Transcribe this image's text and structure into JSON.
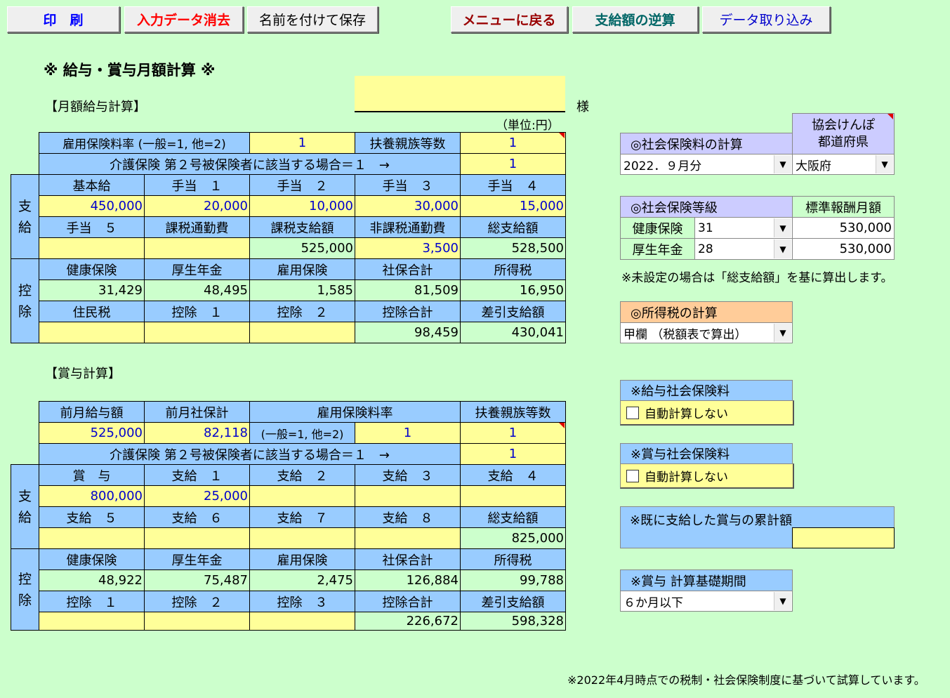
{
  "toolbar": {
    "print": "印　刷",
    "clear": "入力データ消去",
    "save_as": "名前を付けて保存",
    "menu": "メニューに戻る",
    "reverse": "支給額の逆算",
    "import": "データ取り込み"
  },
  "page_title": "※ 給与・賞与月額計算 ※",
  "monthly": {
    "section_label": "【月額給与計算】",
    "name_value": "",
    "sama": "様",
    "unit": "（単位:円）",
    "rate_label": "雇用保険料率 (一般=1, 他=2)",
    "rate_value": "1",
    "dependents_label": "扶養親族等数",
    "dependents_value": "1",
    "kaigo_label": "介護保険 第２号被保険者に該当する場合＝１　→",
    "kaigo_value": "1",
    "pay_side": [
      "支",
      "給"
    ],
    "ded_side": [
      "控",
      "除"
    ],
    "pay_h1": [
      "基本給",
      "手当　１",
      "手当　２",
      "手当　３",
      "手当　４"
    ],
    "pay_v1": [
      "450,000",
      "20,000",
      "10,000",
      "30,000",
      "15,000"
    ],
    "pay_h2": [
      "手当　５",
      "課税通勤費",
      "課税支給額",
      "非課税通勤費",
      "総支給額"
    ],
    "pay_v2": [
      "",
      "",
      "525,000",
      "3,500",
      "528,500"
    ],
    "ded_h1": [
      "健康保険",
      "厚生年金",
      "雇用保険",
      "社保合計",
      "所得税"
    ],
    "ded_v1": [
      "31,429",
      "48,495",
      "1,585",
      "81,509",
      "16,950"
    ],
    "ded_h2": [
      "住民税",
      "控除　１",
      "控除　２",
      "控除合計",
      "差引支給額"
    ],
    "ded_v2": [
      "",
      "",
      "",
      "98,459",
      "430,041"
    ]
  },
  "bonus": {
    "section_label": "【賞与計算】",
    "h0": [
      "前月給与額",
      "前月社保計",
      "雇用保険料率",
      "扶養親族等数"
    ],
    "prev_salary": "525,000",
    "prev_social": "82,118",
    "rate_sub": "(一般=1, 他=2)",
    "rate_value": "1",
    "dependents_value": "1",
    "kaigo_label": "介護保険 第２号被保険者に該当する場合＝１　→",
    "kaigo_value": "1",
    "pay_h1": [
      "賞　与",
      "支給　１",
      "支給　２",
      "支給　３",
      "支給　４"
    ],
    "pay_v1": [
      "800,000",
      "25,000",
      "",
      "",
      ""
    ],
    "pay_h2": [
      "支給　５",
      "支給　６",
      "支給　７",
      "支給　８",
      "総支給額"
    ],
    "pay_v2": [
      "",
      "",
      "",
      "",
      "825,000"
    ],
    "ded_h1": [
      "健康保険",
      "厚生年金",
      "雇用保険",
      "社保合計",
      "所得税"
    ],
    "ded_v1": [
      "48,922",
      "75,487",
      "2,475",
      "126,884",
      "99,788"
    ],
    "ded_h2": [
      "控除　１",
      "控除　２",
      "控除　３",
      "控除合計",
      "差引支給額"
    ],
    "ded_v2": [
      "",
      "",
      "",
      "226,672",
      "598,328"
    ]
  },
  "right": {
    "social_calc_label": "◎社会保険料の計算",
    "social_calc_value": "2022．９月分",
    "kyokai_label": "協会けんぽ\n都道府県",
    "kyokai_value": "大阪府",
    "grade_label": "◎社会保険等級",
    "std_label": "標準報酬月額",
    "health_label": "健康保険",
    "health_grade": "31",
    "health_std": "530,000",
    "pension_label": "厚生年金",
    "pension_grade": "28",
    "pension_std": "530,000",
    "grade_note": "※未設定の場合は「総支給額」を基に算出します。",
    "tax_calc_label": "◎所得税の計算",
    "tax_calc_value": "甲欄 （税額表で算出）",
    "salary_social_label": "※給与社会保険料",
    "salary_social_cb": "自動計算しない",
    "bonus_social_label": "※賞与社会保険料",
    "bonus_social_cb": "自動計算しない",
    "cumulative_label": "※既に支給した賞与の累計額",
    "cumulative_value": "",
    "period_label": "※賞与 計算基礎期間",
    "period_value": "６か月以下"
  },
  "footer_note": "※2022年4月時点での税制・社会保険制度に基づいて試算しています。",
  "colors": {
    "bg": "#ccffcc",
    "header": "#99ccff",
    "input": "#ffff99",
    "purple": "#ccccff",
    "orange": "#ffcc99"
  }
}
